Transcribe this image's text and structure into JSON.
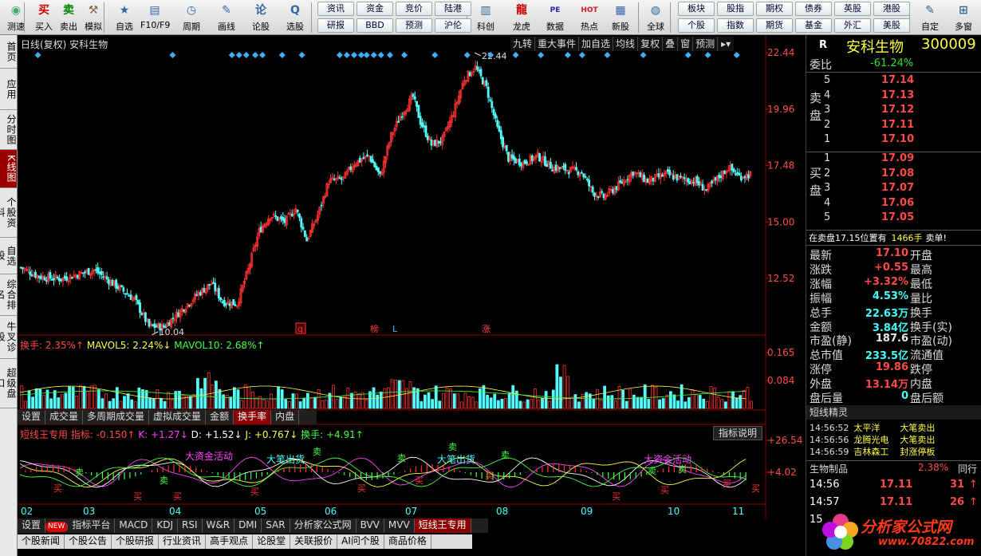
{
  "toolbar": {
    "buttons": [
      {
        "label": "测速",
        "icon": "speed-test-icon",
        "glyph": "◉"
      },
      {
        "label": "买入",
        "icon": "buy-icon",
        "glyph": "买"
      },
      {
        "label": "卖出",
        "icon": "sell-icon",
        "glyph": "卖"
      },
      {
        "label": "模拟",
        "icon": "simulate-icon",
        "glyph": "⚒"
      },
      {
        "label": "自选",
        "icon": "favorites-icon",
        "glyph": "★"
      },
      {
        "label": "F10/F9",
        "icon": "f10-icon",
        "glyph": "▤"
      },
      {
        "label": "周期",
        "icon": "period-icon",
        "glyph": "◷"
      },
      {
        "label": "画线",
        "icon": "draw-line-icon",
        "glyph": "✎"
      },
      {
        "label": "论股",
        "icon": "discuss-icon",
        "glyph": "论"
      },
      {
        "label": "选股",
        "icon": "stock-picker-icon",
        "glyph": "Q"
      },
      {
        "label": "科创",
        "icon": "star-market-icon",
        "glyph": "▥"
      },
      {
        "label": "龙虎",
        "icon": "dragon-tiger-icon",
        "glyph": "龍"
      },
      {
        "label": "数据",
        "icon": "data-icon",
        "glyph": "PE"
      },
      {
        "label": "热点",
        "icon": "hotspot-icon",
        "glyph": "HOT"
      },
      {
        "label": "新股",
        "icon": "new-stock-icon",
        "glyph": "▦"
      },
      {
        "label": "全球",
        "icon": "globe-icon",
        "glyph": "◍"
      },
      {
        "label": "自定",
        "icon": "custom-icon",
        "glyph": "✎"
      },
      {
        "label": "多窗",
        "icon": "multi-window-icon",
        "glyph": "⊞"
      }
    ],
    "pills_top": [
      "资讯",
      "资金",
      "竞价",
      "陆港",
      "板块",
      "股指",
      "期权",
      "债券",
      "英股",
      "港股"
    ],
    "pills_bottom": [
      "研报",
      "BBD",
      "预测",
      "沪伦",
      "个股",
      "指数",
      "期货",
      "基金",
      "外汇",
      "美股"
    ]
  },
  "lefttabs": [
    "首页",
    "应用",
    "分时图",
    "K线图",
    "个股资料",
    "自选股",
    "综合排名",
    "牛叉诊股",
    "超级盘口"
  ],
  "chart": {
    "header_title": "日线(复权) 安科生物",
    "header_buttons": [
      "九转",
      "重大事件",
      "加自选",
      "均线",
      "复权",
      "叠",
      "窗",
      "预测"
    ],
    "price_labels": [
      "22.44",
      "19.96",
      "17.48",
      "15.00",
      "12.52"
    ],
    "annot_high": "22.44",
    "annot_low": "10.04",
    "event_markers": [
      "q",
      "榜",
      "L",
      "涨"
    ],
    "vol_legend": {
      "a": "换手: 2.35%↑",
      "b": "MAVOL5: 2.24%↓",
      "c": "MAVOL10: 2.68%↑"
    },
    "vol_labels": [
      "0.165",
      "0.084"
    ],
    "vol_tabs": [
      "设置",
      "成交量",
      "多周期成交量",
      "虚拟成交量",
      "金额",
      "换手率",
      "内盘"
    ],
    "ind_legend": {
      "name": "短线王专用",
      "zb": "指标: -0.150↑",
      "k": "K: +1.27↓",
      "d": "D: +1.52↓",
      "j": "J: +0.767↓",
      "hs": "换手: +4.91↑"
    },
    "ind_button": "指标说明",
    "ind_labels": [
      "+26.54",
      "+4.02"
    ],
    "ind_texts": [
      "大资金活动",
      "大笔出货",
      "大笔出货",
      "大资金活动"
    ],
    "months": [
      "02",
      "03",
      "04",
      "05",
      "06",
      "07",
      "08",
      "09",
      "10",
      "11"
    ],
    "bottom_tabs": [
      "设置",
      "NEW",
      "指标平台",
      "MACD",
      "KDJ",
      "RSI",
      "W&R",
      "DMI",
      "SAR",
      "分析家公式网",
      "BVV",
      "MVV",
      "短线王专用"
    ],
    "news_tabs": [
      "个股新闻",
      "个股公告",
      "个股研报",
      "行业资讯",
      "高手观点",
      "论股堂",
      "关联报价",
      "AI问个股",
      "商品价格"
    ]
  },
  "quote": {
    "flag": "R",
    "name": "安科生物",
    "code": "300009",
    "weibi_label": "委比",
    "weibi": "-61.24%",
    "sell_label": "卖盘",
    "buy_label": "买盘",
    "sells": [
      {
        "n": "5",
        "p": "17.14"
      },
      {
        "n": "4",
        "p": "17.13"
      },
      {
        "n": "3",
        "p": "17.12"
      },
      {
        "n": "2",
        "p": "17.11"
      },
      {
        "n": "1",
        "p": "17.10"
      }
    ],
    "buys": [
      {
        "n": "1",
        "p": "17.09"
      },
      {
        "n": "2",
        "p": "17.08"
      },
      {
        "n": "3",
        "p": "17.07"
      },
      {
        "n": "4",
        "p": "17.06"
      },
      {
        "n": "5",
        "p": "17.05"
      }
    ],
    "notice_a": "在卖盘17.15位置有",
    "notice_b": "1466手",
    "notice_c": "卖单!",
    "stats": [
      {
        "l": "最新",
        "v": "17.10",
        "r": "开盘",
        "c": "red"
      },
      {
        "l": "涨跌",
        "v": "+0.55",
        "r": "最高",
        "c": "red"
      },
      {
        "l": "涨幅",
        "v": "+3.32%",
        "r": "最低",
        "c": "red"
      },
      {
        "l": "振幅",
        "v": "4.53%",
        "r": "量比",
        "c": "cyn"
      },
      {
        "l": "总手",
        "v": "22.63万",
        "r": "换手",
        "c": "cyn"
      },
      {
        "l": "金额",
        "v": "3.84亿",
        "r": "换手(实)",
        "c": "cyn"
      },
      {
        "l": "市盈(静)",
        "v": "187.6",
        "r": "市盈(动)",
        "c": "wht"
      },
      {
        "l": "总市值",
        "v": "233.5亿",
        "r": "流通值",
        "c": "cyn"
      },
      {
        "l": "涨停",
        "v": "19.86",
        "r": "跌停",
        "c": "red"
      },
      {
        "l": "外盘",
        "v": "13.14万",
        "r": "内盘",
        "c": "red"
      },
      {
        "l": "盘后量",
        "v": "0",
        "r": "盘后额",
        "c": "cyn"
      }
    ],
    "elf_title": "短线精灵",
    "elf": [
      {
        "t": "14:56:52",
        "n": "太平洋",
        "s": "大笔卖出"
      },
      {
        "t": "14:56:56",
        "n": "龙腾光电",
        "s": "大笔卖出"
      },
      {
        "t": "14:56:59",
        "n": "吉林森工",
        "s": "封涨停板"
      }
    ],
    "sector": {
      "name": "生物制品",
      "pct": "2.38%",
      "more": "同行"
    },
    "ticks": [
      {
        "t": "14:56",
        "p": "17.11",
        "v": "31",
        "d": "↑"
      },
      {
        "t": "14:57",
        "p": "17.11",
        "v": "26",
        "d": "↑"
      }
    ],
    "tick_partial": "15",
    "watermark": "分析家公式网",
    "watermark_url": "www.70822.com"
  }
}
